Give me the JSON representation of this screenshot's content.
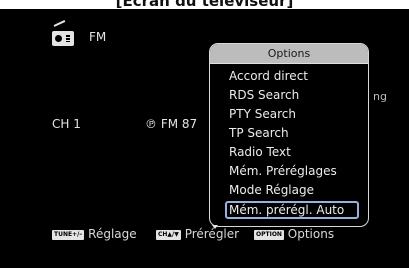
{
  "caption": "[Écran du téléviseur]",
  "source": {
    "band": "FM",
    "channel": "CH 1",
    "frequency": "FM 87"
  },
  "background_fragment": "ng",
  "options": {
    "title": "Options",
    "items": [
      "Accord direct",
      "RDS Search",
      "PTY Search",
      "TP Search",
      "Radio Text",
      "Mém. Préréglages",
      "Mode Réglage",
      "Mém. prérégl. Auto"
    ],
    "selected_index": 7
  },
  "hints": [
    {
      "key": "TUNE+/–",
      "label": "Réglage"
    },
    {
      "key": "CH▲/▼",
      "label": "Prérégler"
    },
    {
      "key": "OPTION",
      "label": "Options"
    }
  ],
  "colors": {
    "screen_bg": "#000000",
    "header_bg": "#bcbcbc",
    "selection_border": "#9ab0e0"
  }
}
